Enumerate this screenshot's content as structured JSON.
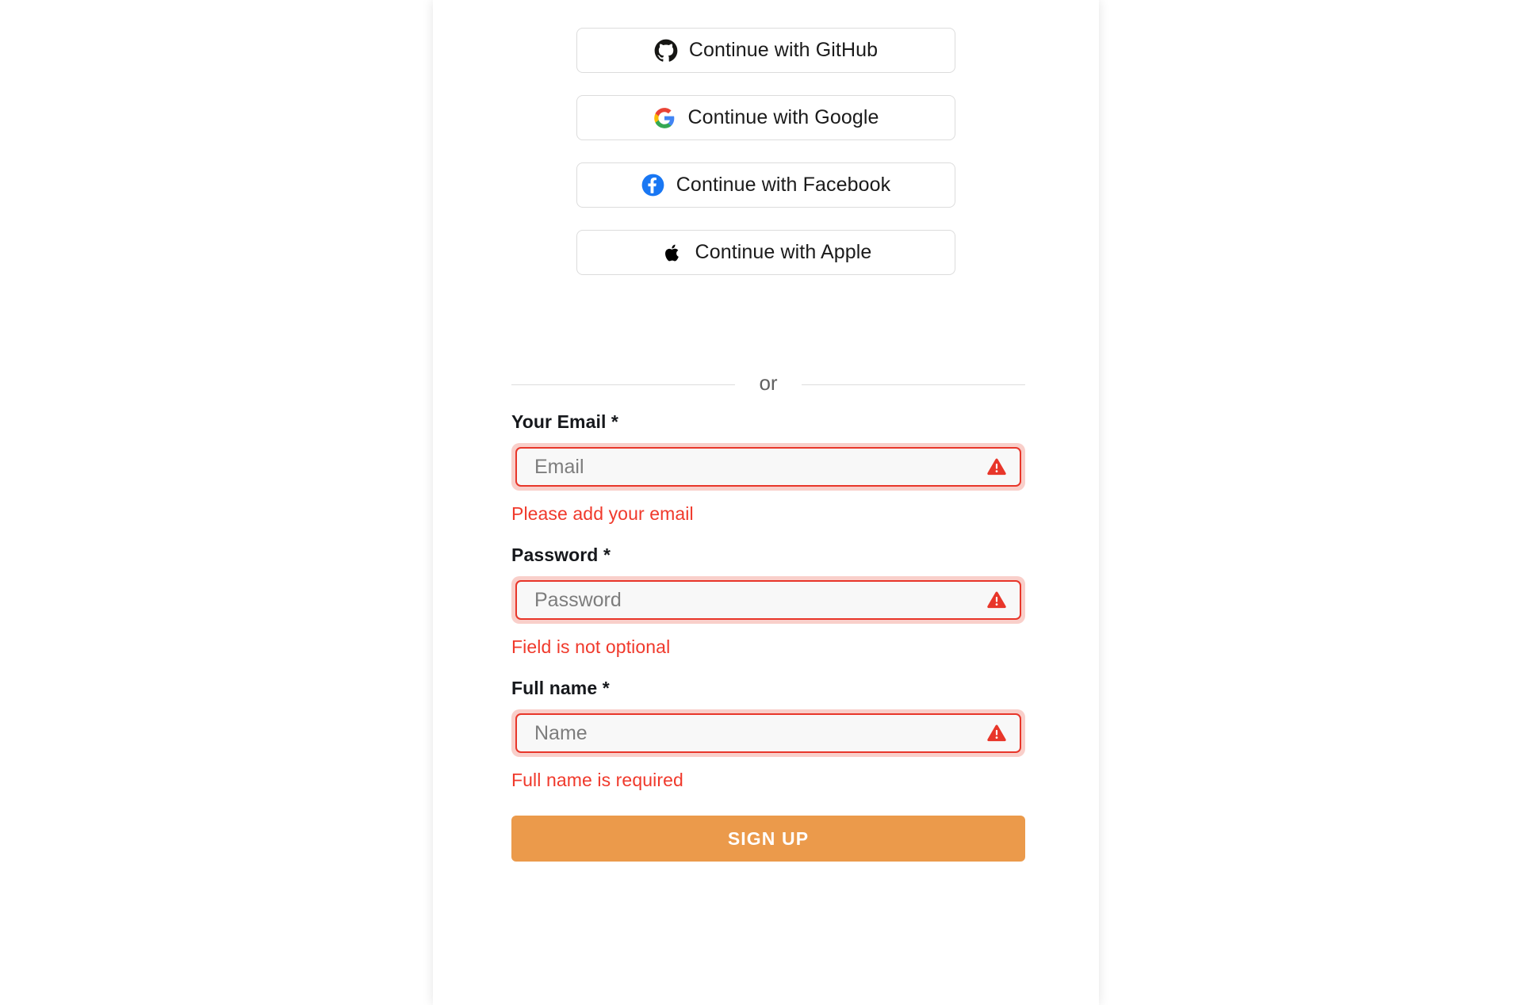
{
  "social_buttons": [
    {
      "label": "Continue with GitHub",
      "icon": "github-icon"
    },
    {
      "label": "Continue with Google",
      "icon": "google-icon"
    },
    {
      "label": "Continue with Facebook",
      "icon": "facebook-icon"
    },
    {
      "label": "Continue with Apple",
      "icon": "apple-icon"
    }
  ],
  "divider": {
    "text": "or"
  },
  "form": {
    "email": {
      "label": "Your Email *",
      "placeholder": "Email",
      "value": "",
      "error": "Please add your email",
      "icon": "warning-triangle-icon"
    },
    "password": {
      "label": "Password *",
      "placeholder": "Password",
      "value": "",
      "error": "Field is not optional",
      "icon": "warning-triangle-icon"
    },
    "fullname": {
      "label": "Full name *",
      "placeholder": "Name",
      "value": "",
      "error": "Full name is required",
      "icon": "warning-triangle-icon"
    },
    "submit_label": "SIGN UP"
  },
  "colors": {
    "error_red": "#f0392b",
    "error_border": "#e8362a",
    "error_halo": "#f9cfca",
    "submit_orange": "#eb9a4b",
    "button_border": "#dcdcdc",
    "divider_gray": "#dddddd",
    "placeholder_gray": "#7d7d7d",
    "facebook_blue": "#1977f3",
    "google_blue": "#4285f4",
    "google_green": "#34a853",
    "google_yellow": "#fbbc05",
    "google_red": "#ea4335"
  }
}
